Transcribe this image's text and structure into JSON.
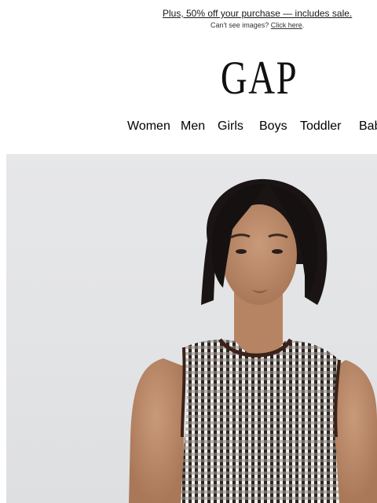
{
  "promo": {
    "text": "Plus, 50% off your purchase — includes sale.",
    "cant_see_prefix": "Can't see images?",
    "click_here": "Click here",
    "period": "."
  },
  "logo": {
    "text": "GAP"
  },
  "nav": {
    "items": [
      "Women",
      "Men",
      "Girls",
      "Boys",
      "Toddler",
      "Bab"
    ]
  },
  "colors": {
    "background": "#ffffff",
    "hero_bg": "#e4e5e7",
    "text": "#000000"
  }
}
